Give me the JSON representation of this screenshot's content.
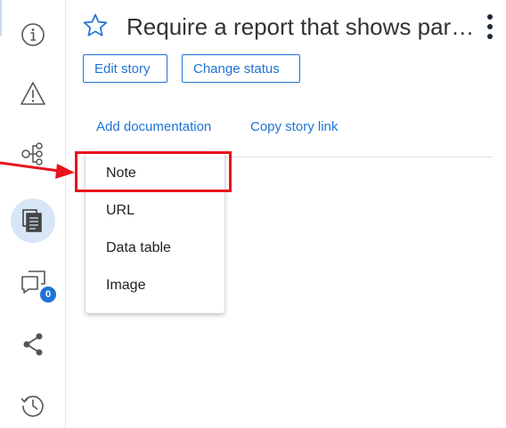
{
  "header": {
    "title": "Require a report that shows part…",
    "edit_story_label": "Edit story",
    "change_status_label": "Change status"
  },
  "links": {
    "add_documentation": "Add documentation",
    "copy_story_link": "Copy story link"
  },
  "menu": {
    "items": [
      "Note",
      "URL",
      "Data table",
      "Image"
    ]
  },
  "sidebar": {
    "items": [
      {
        "icon": "info-icon"
      },
      {
        "icon": "warning-icon"
      },
      {
        "icon": "hierarchy-icon"
      },
      {
        "icon": "documents-icon",
        "active": true
      },
      {
        "icon": "comments-icon",
        "badge": "0"
      },
      {
        "icon": "share-icon"
      },
      {
        "icon": "history-icon"
      }
    ]
  },
  "colors": {
    "accent": "#1f73d6",
    "annotation": "#e8141c",
    "active_bg": "#d7e6f6",
    "icon": "#555555"
  }
}
